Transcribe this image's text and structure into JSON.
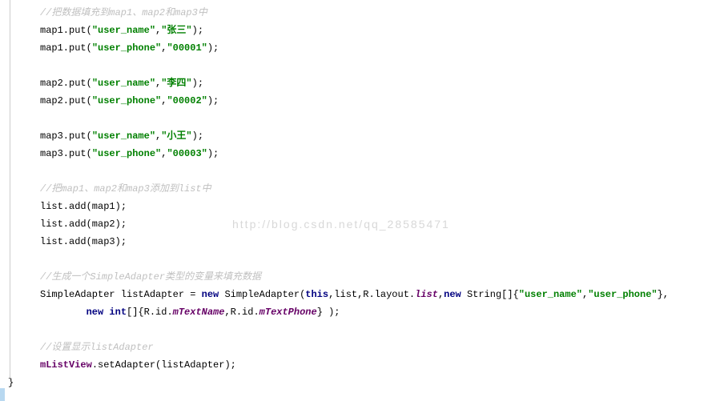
{
  "watermark": "http://blog.csdn.net/qq_28585471",
  "code": {
    "c1": "//把数据填充到map1、map2和map3中",
    "l1a": "map1.put(",
    "l1s1": "\"user_name\"",
    "l1s2": "\"张三\"",
    "l1b": ");",
    "l2a": "map1.put(",
    "l2s1": "\"user_phone\"",
    "l2s2": "\"00001\"",
    "l2b": ");",
    "l3a": "map2.put(",
    "l3s1": "\"user_name\"",
    "l3s2": "\"李四\"",
    "l3b": ");",
    "l4a": "map2.put(",
    "l4s1": "\"user_phone\"",
    "l4s2": "\"00002\"",
    "l4b": ");",
    "l5a": "map3.put(",
    "l5s1": "\"user_name\"",
    "l5s2": "\"小王\"",
    "l5b": ");",
    "l6a": "map3.put(",
    "l6s1": "\"user_phone\"",
    "l6s2": "\"00003\"",
    "l6b": ");",
    "c2": "//把map1、map2和map3添加到list中",
    "l7": "list.add(map1);",
    "l8": "list.add(map2);",
    "l9": "list.add(map3);",
    "c3": "//生成一个SimpleAdapter类型的变量来填充数据",
    "l10a": "SimpleAdapter listAdapter = ",
    "l10kw1": "new",
    "l10b": " SimpleAdapter(",
    "l10kw2": "this",
    "l10c": ",list,R.layout.",
    "l10id1": "list",
    "l10d": ",",
    "l10kw3": "new",
    "l10e": " String[]{",
    "l10s1": "\"user_name\"",
    "l10s2": "\"user_phone\"",
    "l10f": "},",
    "l11kw": "new int",
    "l11a": "[]{R.id.",
    "l11id1": "mTextName",
    "l11b": ",R.id.",
    "l11id2": "mTextPhone",
    "l11c": "} );",
    "c4": "//设置显示listAdapter",
    "l12a": "mListView",
    "l12b": ".setAdapter(listAdapter);",
    "brace": "}"
  }
}
